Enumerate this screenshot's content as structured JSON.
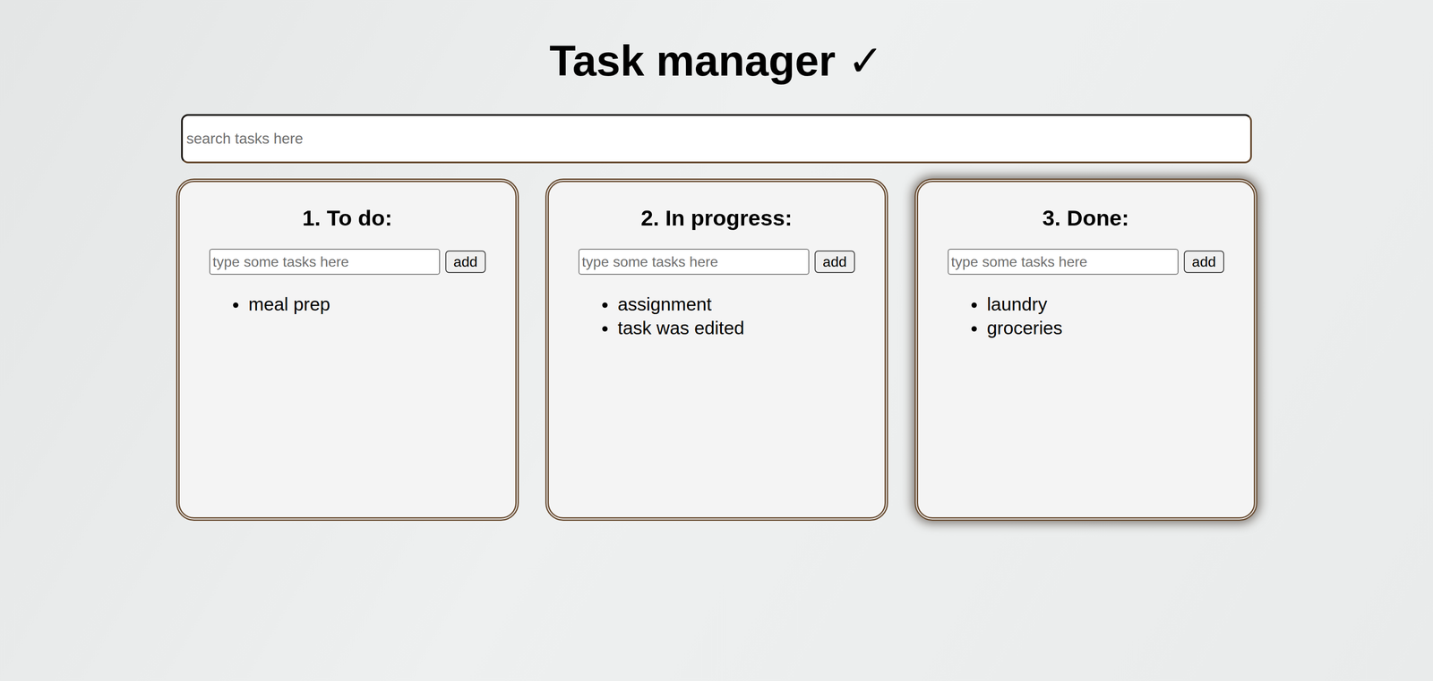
{
  "title": "Task manager ✓",
  "search": {
    "placeholder": "search tasks here"
  },
  "columns": [
    {
      "heading": "1. To do:",
      "placeholder": "type some tasks here",
      "button": "add",
      "tasks": [
        "meal prep"
      ],
      "hovered": false
    },
    {
      "heading": "2. In progress:",
      "placeholder": "type some tasks here",
      "button": "add",
      "tasks": [
        "assignment",
        "task was edited"
      ],
      "hovered": false
    },
    {
      "heading": "3. Done:",
      "placeholder": "type some tasks here",
      "button": "add",
      "tasks": [
        "laundry",
        "groceries"
      ],
      "hovered": true
    }
  ]
}
